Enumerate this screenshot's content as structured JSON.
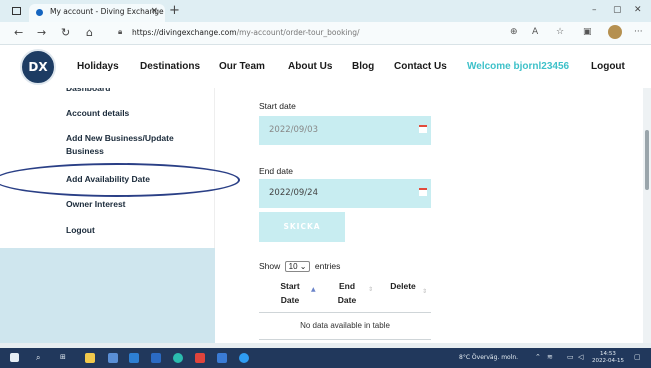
{
  "browser": {
    "tab_title": "My account - Diving Exchange",
    "tab_close": "×",
    "new_tab": "+",
    "url_domain": "https://divingexchange.com",
    "url_path": "/my-account/order-tour_booking/",
    "minimize": "–",
    "maximize": "▢",
    "close": "✕",
    "back": "←",
    "forward": "→",
    "reload": "↻",
    "home": "⌂",
    "more": "···"
  },
  "site": {
    "logo_text": "DX",
    "menu": [
      "Holidays",
      "Destinations",
      "Our Team",
      "About Us",
      "Blog",
      "Contact Us"
    ],
    "welcome": "Welcome bjornl23456",
    "logout": "Logout"
  },
  "sidebar": {
    "items": [
      "Dashboard",
      "Account details",
      "Add New Business/Update Business",
      "Add Availability Date",
      "Owner Interest",
      "Logout"
    ]
  },
  "form": {
    "start_label": "Start date",
    "start_value": "2022/09/03",
    "end_label": "End date",
    "end_value": "2022/09/24",
    "submit_label": "SKICKA"
  },
  "table": {
    "show_prefix": "Show",
    "page_size": "10",
    "show_suffix": "entries",
    "columns": [
      "Start Date",
      "End Date",
      "Delete"
    ],
    "empty_message": "No data available in table"
  },
  "taskbar": {
    "weather": "8°C Överväg. moln.",
    "time": "14:53",
    "date": "2022-04-15"
  },
  "colors": {
    "accent": "#3ec1c9",
    "input_bg": "#c8edf1",
    "annotation": "#2a3f86",
    "taskbar": "#21385c"
  }
}
